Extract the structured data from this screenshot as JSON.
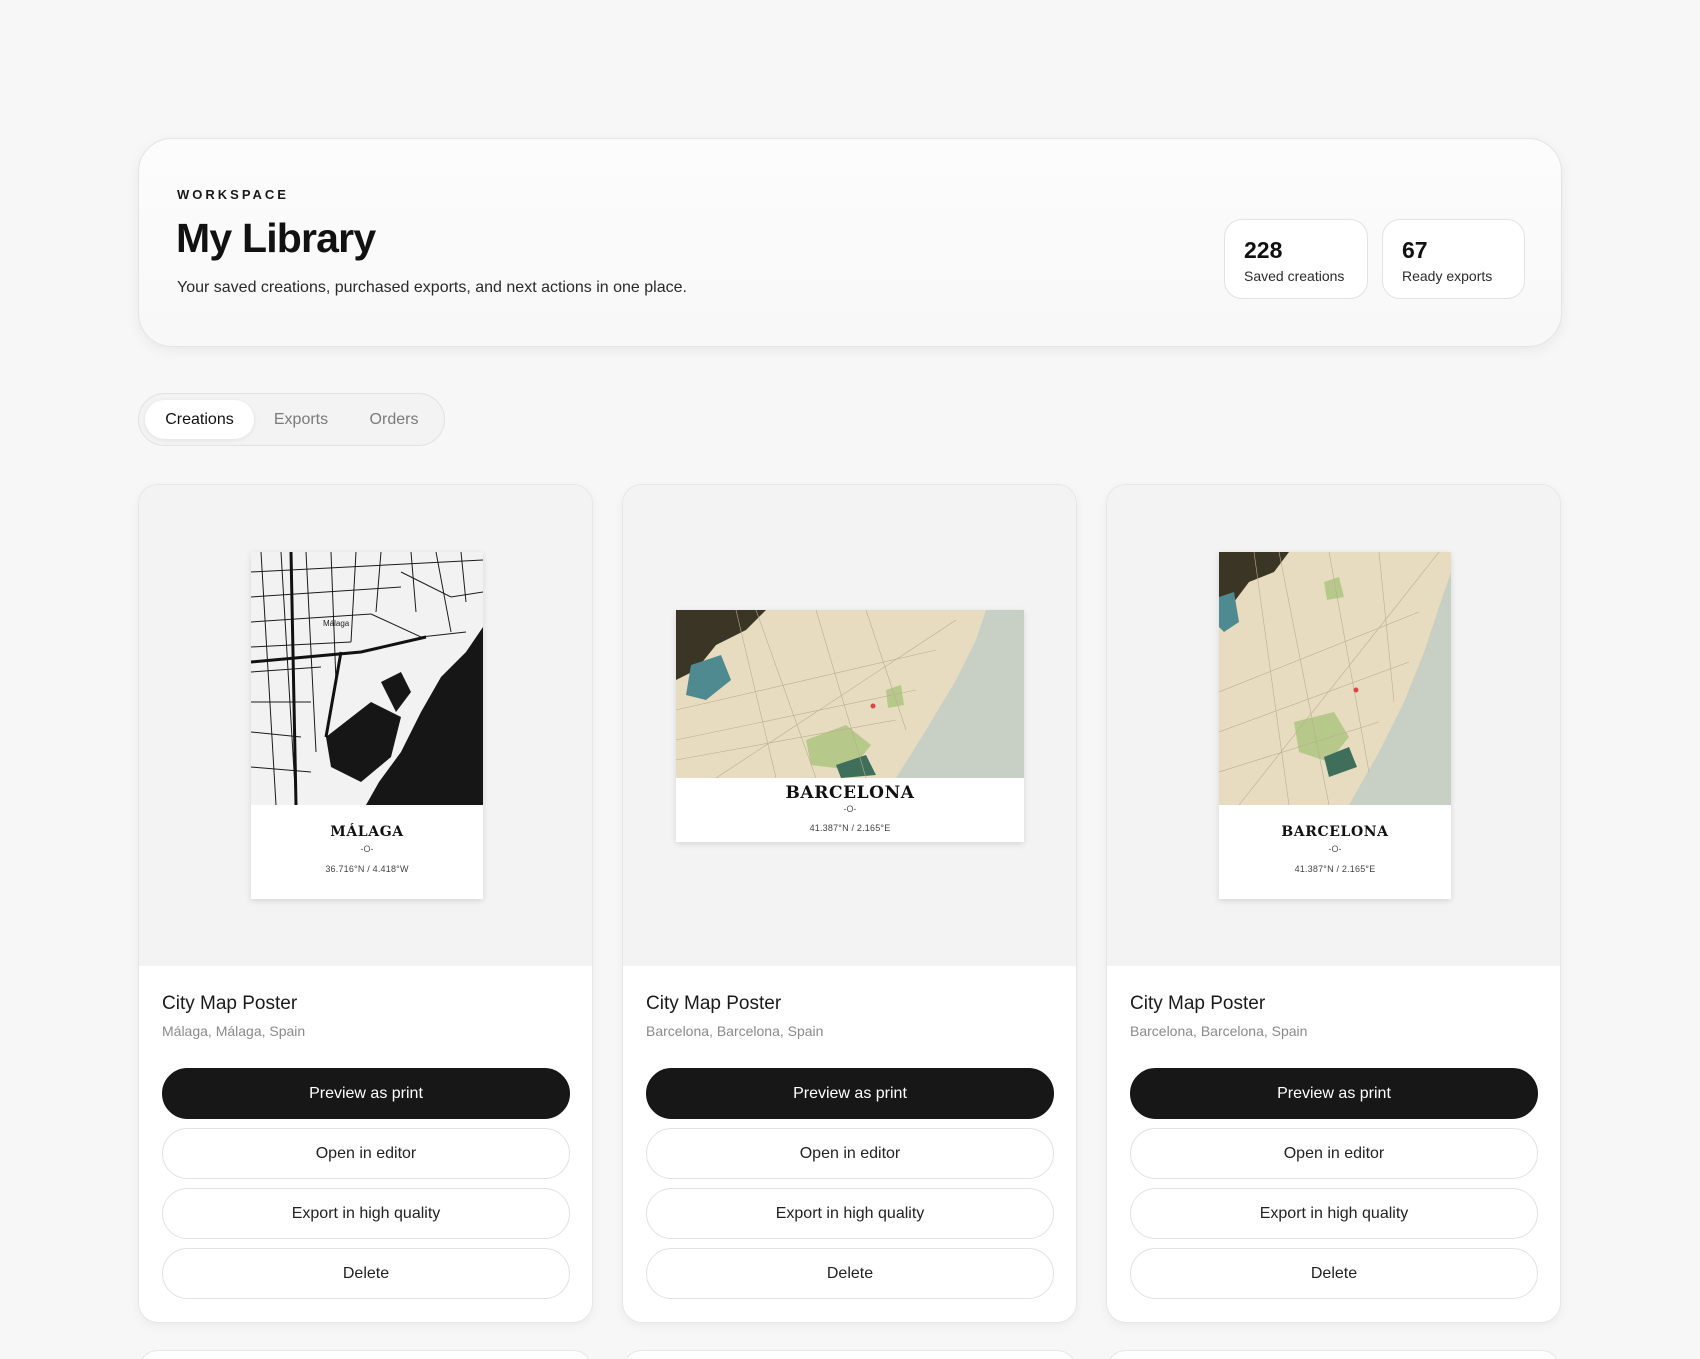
{
  "header": {
    "eyebrow": "WORKSPACE",
    "title": "My Library",
    "subtitle": "Your saved creations, purchased exports, and next actions in one place.",
    "stats": [
      {
        "value": "228",
        "label": "Saved creations"
      },
      {
        "value": "67",
        "label": "Ready exports"
      }
    ]
  },
  "tabs": [
    {
      "label": "Creations",
      "active": true
    },
    {
      "label": "Exports",
      "active": false
    },
    {
      "label": "Orders",
      "active": false
    }
  ],
  "cards": [
    {
      "title": "City Map Poster",
      "location": "Málaga, Málaga, Spain",
      "poster": {
        "city": "MÁLAGA",
        "divider": "-O-",
        "coords": "36.716°N / 4.418°W",
        "orientation": "portrait",
        "style": "monochrome"
      },
      "actions": {
        "preview": "Preview as print",
        "edit": "Open in editor",
        "export": "Export in high quality",
        "delete": "Delete"
      }
    },
    {
      "title": "City Map Poster",
      "location": "Barcelona, Barcelona, Spain",
      "poster": {
        "city": "BARCELONA",
        "divider": "-O-",
        "coords": "41.387°N / 2.165°E",
        "orientation": "landscape",
        "style": "vintage"
      },
      "actions": {
        "preview": "Preview as print",
        "edit": "Open in editor",
        "export": "Export in high quality",
        "delete": "Delete"
      }
    },
    {
      "title": "City Map Poster",
      "location": "Barcelona, Barcelona, Spain",
      "poster": {
        "city": "BARCELONA",
        "divider": "-O-",
        "coords": "41.387°N / 2.165°E",
        "orientation": "portrait",
        "style": "vintage"
      },
      "actions": {
        "preview": "Preview as print",
        "edit": "Open in editor",
        "export": "Export in high quality",
        "delete": "Delete"
      }
    }
  ],
  "colors": {
    "background": "#f7f7f7",
    "primary_button": "#171717",
    "map_land": "#e8dcc0",
    "map_sea": "#c8cfc4",
    "map_park": "#b6c98a",
    "map_dark": "#3b3526",
    "map_water_accent": "#4e8a8f"
  }
}
